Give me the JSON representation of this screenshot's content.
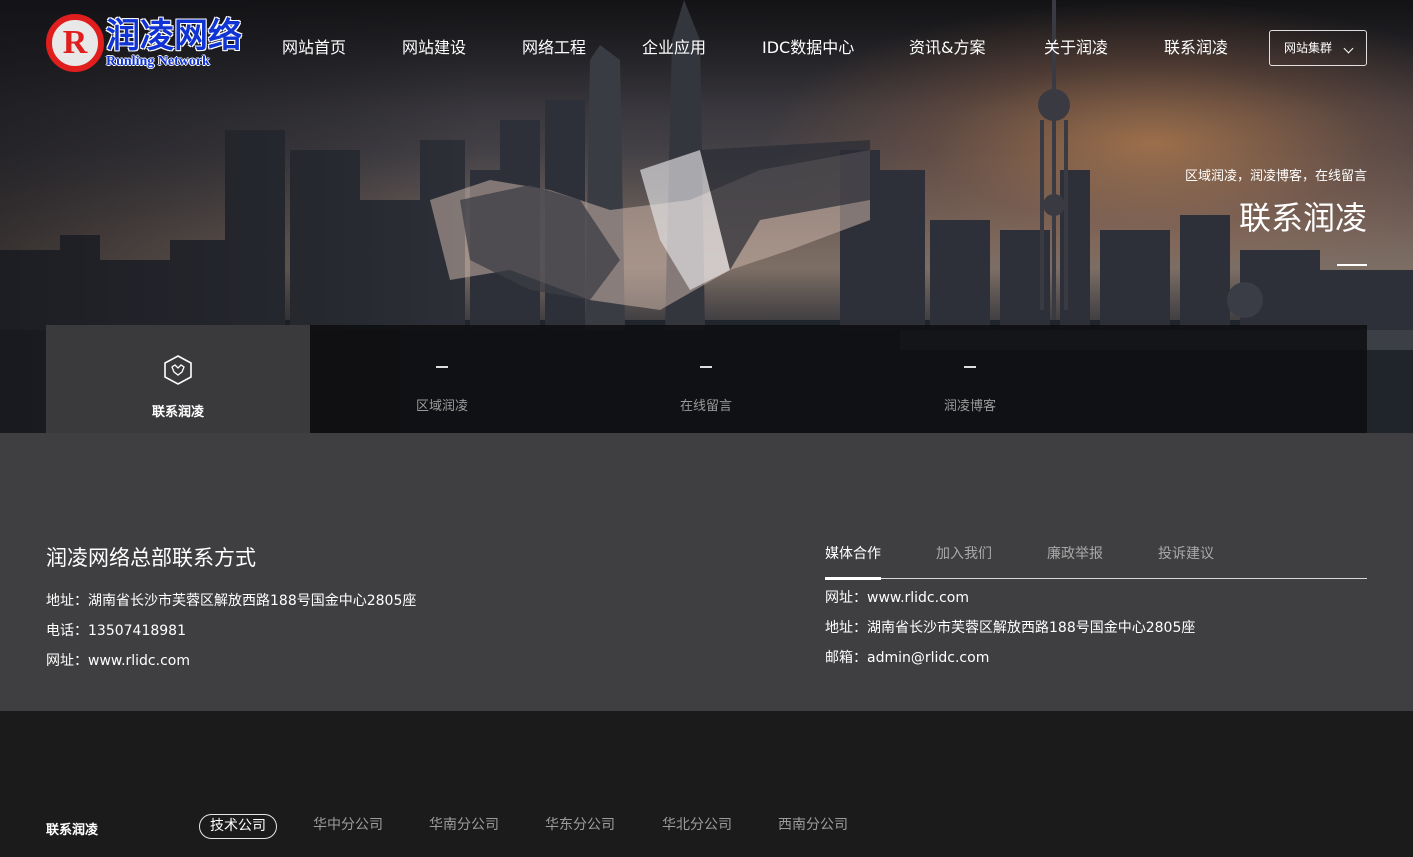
{
  "header": {
    "logo_cn": "润凌网络",
    "logo_en": "Runling Network",
    "nav": [
      "网站首页",
      "网站建设",
      "网络工程",
      "企业应用",
      "IDC数据中心",
      "资讯&方案",
      "关于润凌",
      "联系润凌"
    ],
    "site_group_label": "网站集群"
  },
  "hero": {
    "crumb": "区域润凌，润凌博客，在线留言",
    "title": "联系润凌"
  },
  "subtabs": [
    {
      "label": "联系润凌",
      "active": true
    },
    {
      "label": "区域润凌",
      "active": false
    },
    {
      "label": "在线留言",
      "active": false
    },
    {
      "label": "润凌博客",
      "active": false
    }
  ],
  "contact": {
    "title": "润凌网络总部联系方式",
    "address": "地址：湖南省长沙市芙蓉区解放西路188号国金中心2805座",
    "phone": "电话：13507418981",
    "website": "网址：www.rlidc.com"
  },
  "right_tabs": {
    "items": [
      "媒体合作",
      "加入我们",
      "廉政举报",
      "投诉建议"
    ],
    "active_index": 0,
    "website": "网址：www.rlidc.com",
    "address": "地址：湖南省长沙市芙蓉区解放西路188号国金中心2805座",
    "email": "邮箱：admin@rlidc.com"
  },
  "footer": {
    "label": "联系润凌",
    "branches": [
      "技术公司",
      "华中分公司",
      "华南分公司",
      "华东分公司",
      "华北分公司",
      "西南分公司"
    ],
    "active_index": 0
  },
  "colors": {
    "logo_red": "#e01e1e",
    "logo_blue": "#1034d4",
    "contact_bg": "#3f3f41",
    "footer_bg": "#1b1b1c"
  }
}
